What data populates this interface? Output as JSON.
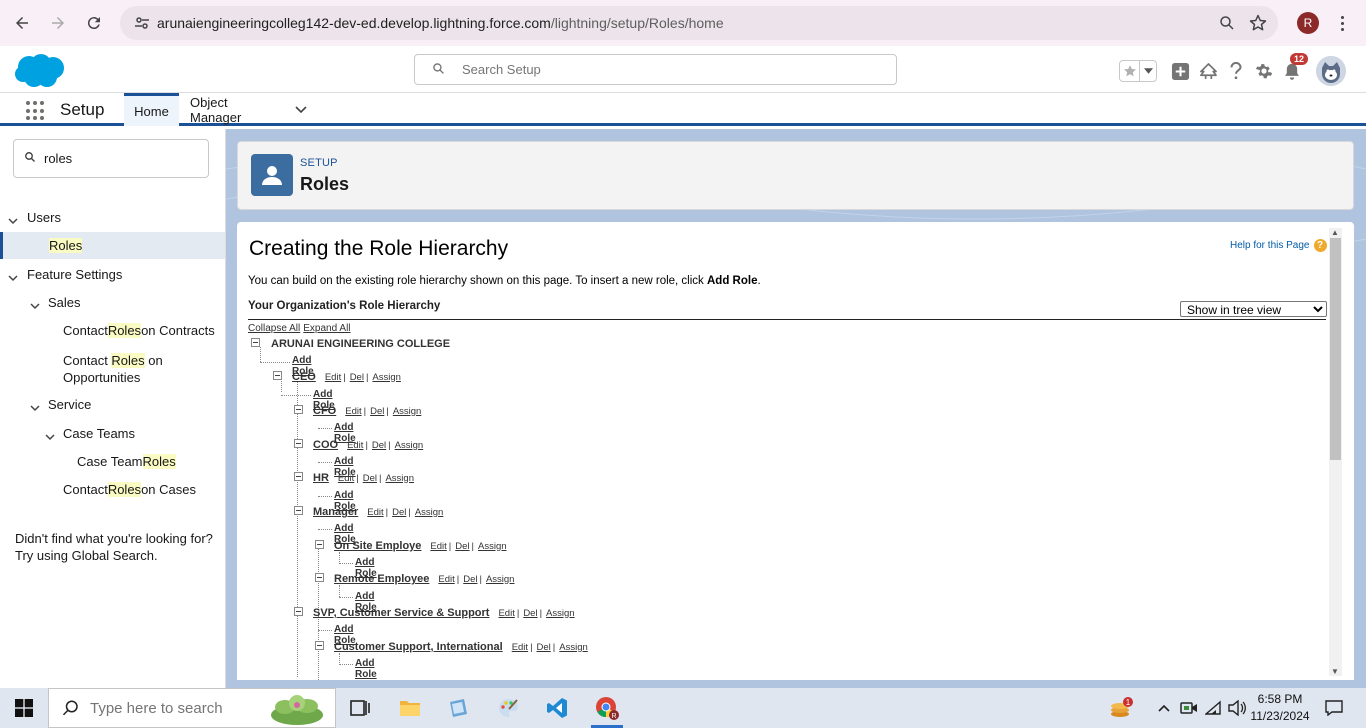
{
  "browser": {
    "url_host": "arunaiengineeringcolleg142-dev-ed.develop.lightning.force.com",
    "url_path": "/lightning/setup/Roles/home",
    "profile_initial": "R"
  },
  "header": {
    "search_placeholder": "Search Setup",
    "notification_count": "12"
  },
  "appnav": {
    "app_name": "Setup",
    "tabs": [
      {
        "label": "Home"
      },
      {
        "label": "Object Manager"
      }
    ]
  },
  "sidebar": {
    "quickfind_value": "roles",
    "users": "Users",
    "roles_hl": "Roles",
    "feature_settings": "Feature Settings",
    "sales": "Sales",
    "contact_roles_contracts": {
      "a": "Contact ",
      "b": "Roles",
      "c": " on Contracts"
    },
    "contact_roles_opps": {
      "a": "Contact ",
      "b": "Roles",
      "c": " on",
      "d": "Opportunities"
    },
    "service": "Service",
    "case_teams": "Case Teams",
    "case_team_roles": {
      "a": "Case Team ",
      "b": "Roles"
    },
    "contact_roles_cases": {
      "a": "Contact ",
      "b": "Roles",
      "c": " on Cases"
    },
    "not_found_1": "Didn't find what you're looking for?",
    "not_found_2": "Try using Global Search."
  },
  "page_header": {
    "overline": "SETUP",
    "title": "Roles"
  },
  "content": {
    "title": "Creating the Role Hierarchy",
    "help_link": "Help for this Page",
    "intro_text": "You can build on the existing role hierarchy shown on this page. To insert a new role, click ",
    "intro_bold": "Add Role",
    "intro_end": ".",
    "hierarchy_title": "Your Organization's Role Hierarchy",
    "view_option": "Show in tree view",
    "collapse_all": "Collapse All",
    "expand_all": "Expand All",
    "edit": "Edit",
    "sep": "|",
    "del": "Del",
    "assign": "Assign",
    "add_role": "Add Role",
    "root": "ARUNAI ENGINEERING COLLEGE",
    "roles": {
      "ceo": "CEO",
      "cfo": "CFO",
      "coo": "COO",
      "hr": "HR",
      "manager": "Manager",
      "onsite": "On Site Employe",
      "remote": "Remote Employee",
      "svp": "SVP, Customer Service & Support",
      "csi": "Customer Support, International"
    }
  },
  "taskbar": {
    "search_placeholder": "Type here to search",
    "time": "6:58 PM",
    "date": "11/23/2024",
    "notif_badge": "1"
  },
  "colors": {
    "brand_blue": "#1b5297",
    "header_icon": "#3b6da0",
    "highlight": "#fafac3",
    "background_band": "#b0c4df"
  }
}
